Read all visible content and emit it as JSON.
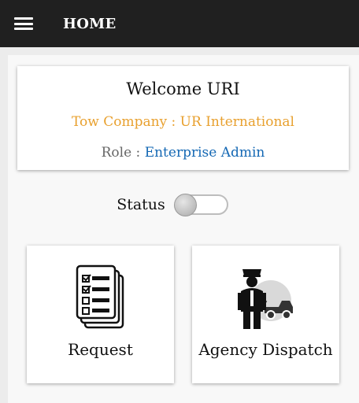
{
  "appbar": {
    "title": "HOME",
    "menu_icon": "hamburger-menu-icon"
  },
  "welcome_card": {
    "welcome": "Welcome URI",
    "company": "Tow Company : UR International",
    "role_label": "Role :",
    "role_value": "Enterprise Admin"
  },
  "status": {
    "label": "Status",
    "enabled": false
  },
  "tiles": [
    {
      "label": "Request",
      "icon": "request-documents-icon"
    },
    {
      "label": "Agency Dispatch",
      "icon": "police-tow-truck-icon"
    }
  ],
  "colors": {
    "appbar": "#202020",
    "company_text": "#e8a02e",
    "role_value_text": "#1468b4",
    "role_label_text": "#666666"
  }
}
